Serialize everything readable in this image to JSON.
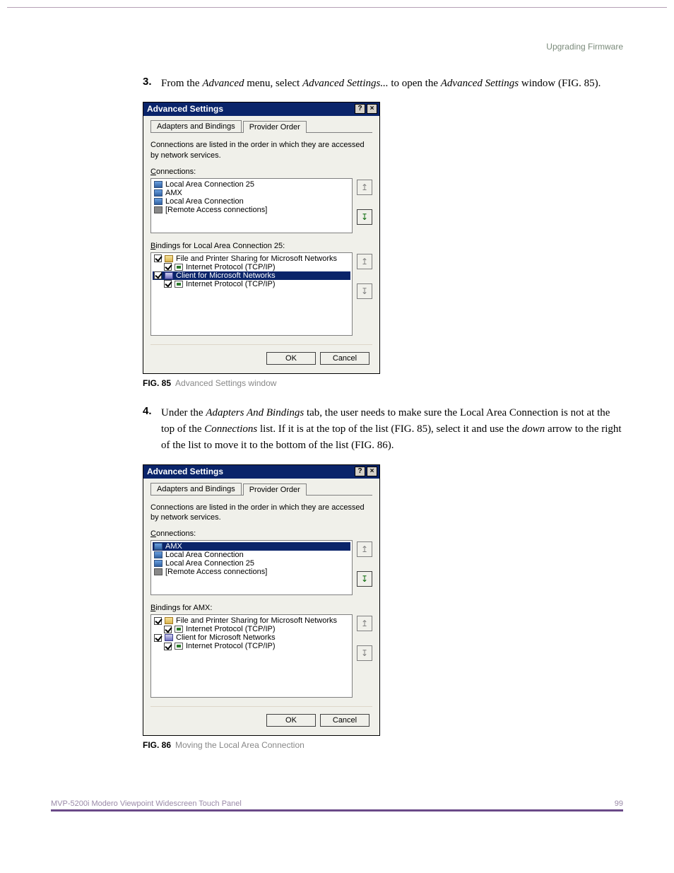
{
  "header": {
    "section": "Upgrading Firmware"
  },
  "step3": {
    "num": "3.",
    "pre": "From the ",
    "i1": "Advanced",
    "mid1": " menu, select ",
    "i2": "Advanced Settings...",
    "mid2": " to open the ",
    "i3": "Advanced Settings",
    "post": " window (FIG. 85)."
  },
  "dlg": {
    "title": "Advanced Settings",
    "help": "?",
    "close": "×",
    "tab_active": "Adapters and Bindings",
    "tab_inactive": "Provider Order",
    "desc": "Connections are listed in the order in which they are accessed by network services.",
    "connections_label": "Connections:",
    "ok": "OK",
    "cancel": "Cancel"
  },
  "dlg1": {
    "conn": [
      "Local Area Connection 25",
      "AMX",
      "Local Area Connection",
      "[Remote Access connections]"
    ],
    "bind_label": "Bindings for Local Area Connection 25:",
    "bind": [
      "File and Printer Sharing for Microsoft Networks",
      "Internet Protocol (TCP/IP)",
      "Client for Microsoft Networks",
      "Internet Protocol (TCP/IP)"
    ],
    "up": "↥",
    "down": "↧"
  },
  "fig85": {
    "label": "FIG. 85",
    "caption": "Advanced Settings window"
  },
  "step4": {
    "num": "4.",
    "pre": "Under the ",
    "i1": "Adapters And Bindings",
    "mid1": " tab, the user needs to make sure the Local Area Connection is not at the top of the ",
    "i2": "Connections",
    "mid2": " list. If it is at the top of the list (FIG. 85), select it and use the ",
    "i3": "down",
    "post": " arrow to the right of the list to move it to the bottom of the list (FIG. 86)."
  },
  "dlg2": {
    "conn": [
      "AMX",
      "Local Area Connection",
      "Local Area Connection 25",
      "[Remote Access connections]"
    ],
    "bind_label": "Bindings for AMX:",
    "bind": [
      "File and Printer Sharing for Microsoft Networks",
      "Internet Protocol (TCP/IP)",
      "Client for Microsoft Networks",
      "Internet Protocol (TCP/IP)"
    ]
  },
  "fig86": {
    "label": "FIG. 86",
    "caption": "Moving the Local Area Connection"
  },
  "footer": {
    "product": "MVP-5200i Modero Viewpoint Widescreen Touch Panel",
    "pagenum": "99"
  }
}
